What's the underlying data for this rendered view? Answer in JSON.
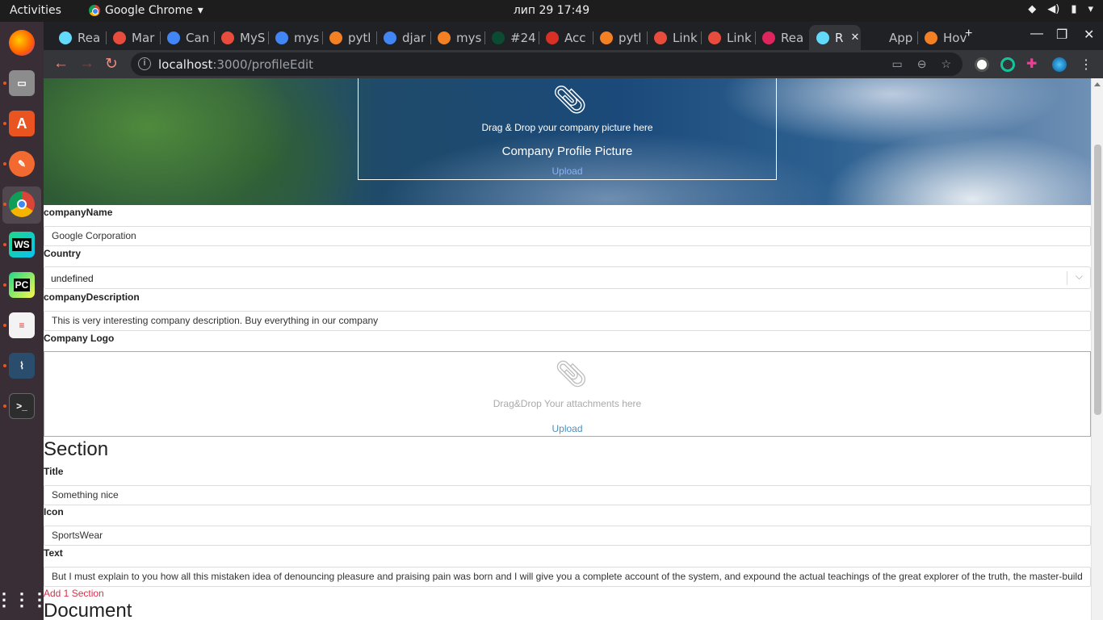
{
  "system": {
    "activities": "Activities",
    "app_name": "Google Chrome",
    "clock": "лип 29  17:49"
  },
  "browser": {
    "tabs": [
      {
        "label": "Rea",
        "color": "#61dafb"
      },
      {
        "label": "Mar",
        "color": "#e74c3c"
      },
      {
        "label": "Can",
        "color": "#4285f4"
      },
      {
        "label": "MyS",
        "color": "#e74c3c"
      },
      {
        "label": "mys",
        "color": "#4285f4"
      },
      {
        "label": "pytl",
        "color": "#f48024"
      },
      {
        "label": "djar",
        "color": "#4285f4"
      },
      {
        "label": "mys",
        "color": "#f48024"
      },
      {
        "label": "#24",
        "color": "#0c4b33"
      },
      {
        "label": "Acc",
        "color": "#d93025"
      },
      {
        "label": "pytl",
        "color": "#f48024"
      },
      {
        "label": "Link",
        "color": "#e74c3c"
      },
      {
        "label": "Link",
        "color": "#e74c3c"
      },
      {
        "label": "Rea",
        "color": "#e0245e"
      },
      {
        "label": "R",
        "color": "#61dafb"
      },
      {
        "label": "App",
        "color": "#202124"
      },
      {
        "label": "Hov",
        "color": "#f48024"
      }
    ],
    "tab_icons": {
      "dj": "dj"
    },
    "url_host": "localhost",
    "url_path": ":3000/profileEdit"
  },
  "page": {
    "company_picture": {
      "hint": "Drag & Drop your company picture here",
      "title": "Company Profile Picture",
      "upload": "Upload"
    },
    "company_name": {
      "label": "companyName",
      "value": "Google Corporation"
    },
    "country": {
      "label": "Country",
      "value": "undefined"
    },
    "company_description": {
      "label": "companyDescription",
      "value": "This is very interesting company description. Buy everything in our company"
    },
    "company_logo": {
      "label": "Company Logo",
      "hint": "Drag&Drop Your attachments here",
      "upload": "Upload"
    },
    "section": {
      "heading": "Section",
      "title": {
        "label": "Title",
        "value": "Something nice"
      },
      "icon": {
        "label": "Icon",
        "value": "SportsWear"
      },
      "text": {
        "label": "Text",
        "value": "But I must explain to you how all this mistaken idea of denouncing pleasure and praising pain was born and I will give you a complete account of the system, and expound the actual teachings of the great explorer of the truth, the master-build"
      },
      "add_link": "Add 1 Section"
    },
    "document": {
      "heading": "Document"
    }
  },
  "colors": {
    "accent_red": "#d9304a",
    "link_blue": "#4a90c2",
    "ubuntu_orange": "#e95420"
  }
}
